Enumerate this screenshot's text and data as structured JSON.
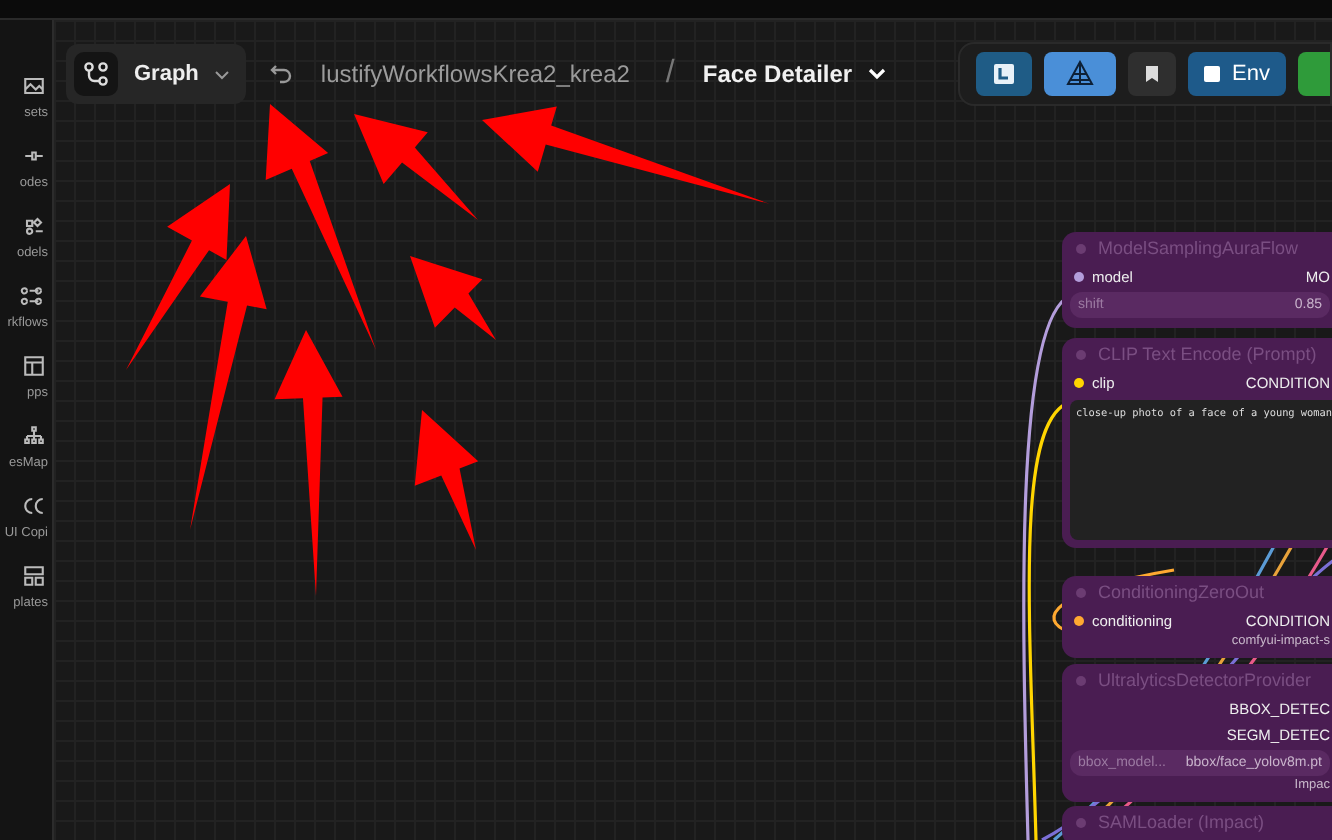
{
  "sidebar": {
    "items": [
      {
        "label": "sets"
      },
      {
        "label": "odes"
      },
      {
        "label": "odels"
      },
      {
        "label": "rkflows"
      },
      {
        "label": "pps"
      },
      {
        "label": "esMap"
      },
      {
        "label": "UI Copi"
      },
      {
        "label": "plates"
      }
    ]
  },
  "toolbar": {
    "graph_button": "Graph",
    "breadcrumb": "lustifyWorkflowsKrea2_krea2",
    "separator": "/",
    "workflow_title": "Face Detailer",
    "buttons": [
      {
        "kind": "panel",
        "selected": false
      },
      {
        "kind": "logo",
        "selected": true
      },
      {
        "kind": "bookmark",
        "selected": false
      },
      {
        "kind": "env",
        "label": "Env",
        "selected": false
      }
    ]
  },
  "nodes": [
    {
      "title": "ModelSamplingAuraFlow",
      "rows": [
        {
          "kind": "port",
          "input": "model",
          "output": "MO",
          "color": "#b39ddb"
        },
        {
          "kind": "widget",
          "name": "shift",
          "value": "0.85"
        }
      ]
    },
    {
      "title": "CLIP Text Encode (Prompt)",
      "rows": [
        {
          "kind": "port",
          "input": "clip",
          "output": "CONDITION",
          "color": "#ffd500"
        },
        {
          "kind": "textarea",
          "value": "close-up photo of a face of a young woman"
        }
      ]
    },
    {
      "title": "ConditioningZeroOut",
      "rows": [
        {
          "kind": "port",
          "input": "conditioning",
          "output": "CONDITION",
          "color": "#ffa931"
        },
        {
          "kind": "source",
          "value": "comfyui-impact-s"
        }
      ]
    },
    {
      "title": "UltralyticsDetectorProvider",
      "rows": [
        {
          "kind": "port",
          "output": "BBOX_DETEC"
        },
        {
          "kind": "port",
          "output": "SEGM_DETEC"
        },
        {
          "kind": "widget",
          "name": "bbox_model...",
          "value": "bbox/face_yolov8m.pt"
        },
        {
          "kind": "source",
          "value": "Impac"
        }
      ]
    },
    {
      "title": "SAMLoader (Impact)"
    }
  ]
}
